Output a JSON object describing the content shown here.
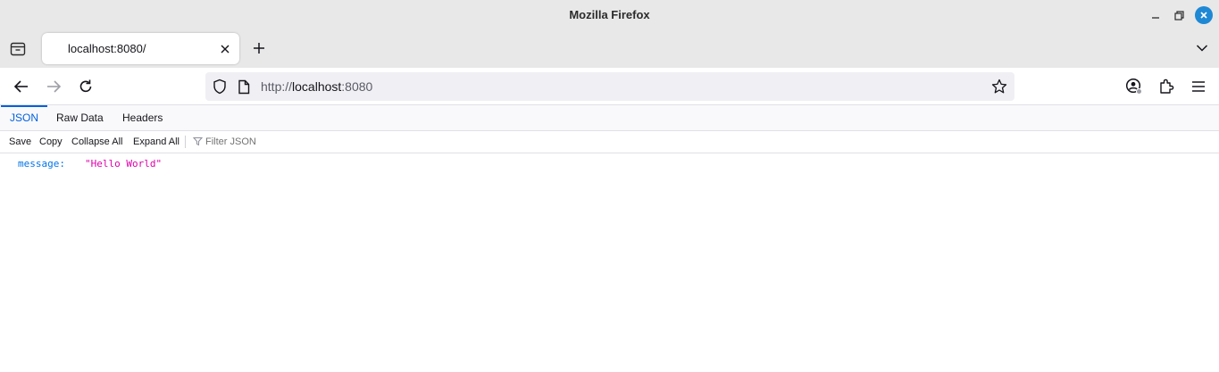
{
  "window": {
    "title": "Mozilla Firefox"
  },
  "tabs": [
    {
      "title": "localhost:8080/",
      "active": true
    }
  ],
  "navbar": {
    "url_scheme": "http://",
    "url_host": "localhost",
    "url_port": ":8080"
  },
  "viewer": {
    "tabs": [
      {
        "label": "JSON",
        "active": true
      },
      {
        "label": "Raw Data",
        "active": false
      },
      {
        "label": "Headers",
        "active": false
      }
    ],
    "toolbar": {
      "save": "Save",
      "copy": "Copy",
      "collapse_all": "Collapse All",
      "expand_all": "Expand All",
      "filter_placeholder": "Filter JSON"
    },
    "rows": [
      {
        "key": "message:",
        "value": "\"Hello World\""
      }
    ]
  },
  "colors": {
    "accent": "#0060df",
    "json_key": "#0074e8",
    "json_string": "#dd00a9",
    "close_button": "#1e88d4"
  }
}
